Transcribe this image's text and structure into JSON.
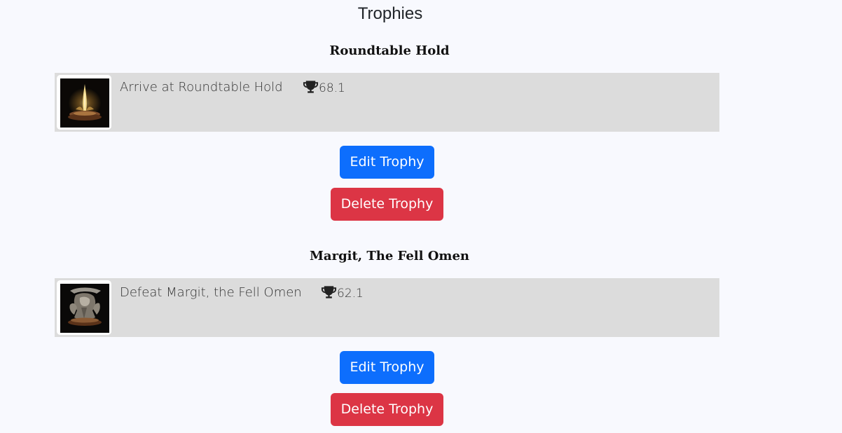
{
  "page": {
    "title": "Trophies"
  },
  "trophies": [
    {
      "name": "Roundtable Hold",
      "description": "Arrive at Roundtable Hold",
      "points": "68.1",
      "image_icon": "site-of-grace-icon",
      "edit_label": "Edit Trophy",
      "delete_label": "Delete Trophy"
    },
    {
      "name": "Margit, The Fell Omen",
      "description": "Defeat Margit, the Fell Omen",
      "points": "62.1",
      "image_icon": "margit-statue-icon",
      "edit_label": "Edit Trophy",
      "delete_label": "Delete Trophy"
    }
  ],
  "colors": {
    "background": "#f8f9fe",
    "card": "#dcdcdc",
    "edit_button": "#0d6efd",
    "delete_button": "#dc3545"
  },
  "icons": {
    "points": "trophy-icon"
  }
}
